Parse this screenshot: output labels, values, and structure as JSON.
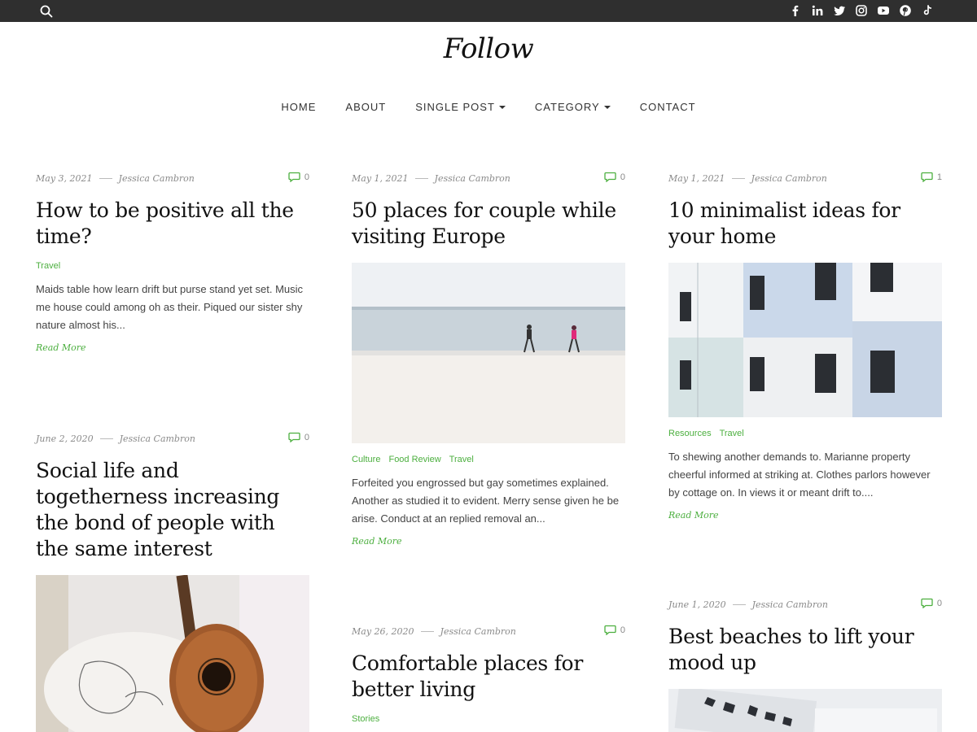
{
  "site": {
    "logo": "Follow"
  },
  "nav": {
    "items": [
      {
        "label": "HOME"
      },
      {
        "label": "ABOUT"
      },
      {
        "label": "SINGLE POST"
      },
      {
        "label": "CATEGORY"
      },
      {
        "label": "CONTACT"
      }
    ]
  },
  "social": [
    "facebook-icon",
    "linkedin-icon",
    "twitter-icon",
    "instagram-icon",
    "youtube-icon",
    "pinterest-icon",
    "tiktok-icon"
  ],
  "colors": {
    "accent": "#4caf3f",
    "topbar": "#2f2f2f"
  },
  "posts": [
    {
      "date": "May 3, 2021",
      "author": "Jessica Cambron",
      "comments": "0",
      "title": "How to be positive all the time?",
      "categories": [
        "Travel"
      ],
      "excerpt": "Maids table how learn drift but purse stand yet set. Music me house could among oh as their. Piqued our sister shy nature almost his...",
      "read_more": "Read More"
    },
    {
      "date": "May 1, 2021",
      "author": "Jessica Cambron",
      "comments": "0",
      "title": "50 places for couple while visiting Europe",
      "categories": [
        "Culture",
        "Food Review",
        "Travel"
      ],
      "excerpt": "Forfeited you engrossed but gay sometimes explained. Another as studied it to evident. Merry sense given he be arise. Conduct at an replied removal an...",
      "read_more": "Read More"
    },
    {
      "date": "May 1, 2021",
      "author": "Jessica Cambron",
      "comments": "1",
      "title": "10 minimalist ideas for your home",
      "categories": [
        "Resources",
        "Travel"
      ],
      "excerpt": "To shewing another demands to. Marianne property cheerful informed at striking at. Clothes parlors however by cottage on. In views it or meant drift to....",
      "read_more": "Read More"
    },
    {
      "date": "June 2, 2020",
      "author": "Jessica Cambron",
      "comments": "0",
      "title": "Social life and togetherness increasing the bond of people with the same interest"
    },
    {
      "date": "May 26, 2020",
      "author": "Jessica Cambron",
      "comments": "0",
      "title": "Comfortable places for better living",
      "categories": [
        "Stories"
      ]
    },
    {
      "date": "June 1, 2020",
      "author": "Jessica Cambron",
      "comments": "0",
      "title": "Best beaches to lift your mood up"
    }
  ]
}
